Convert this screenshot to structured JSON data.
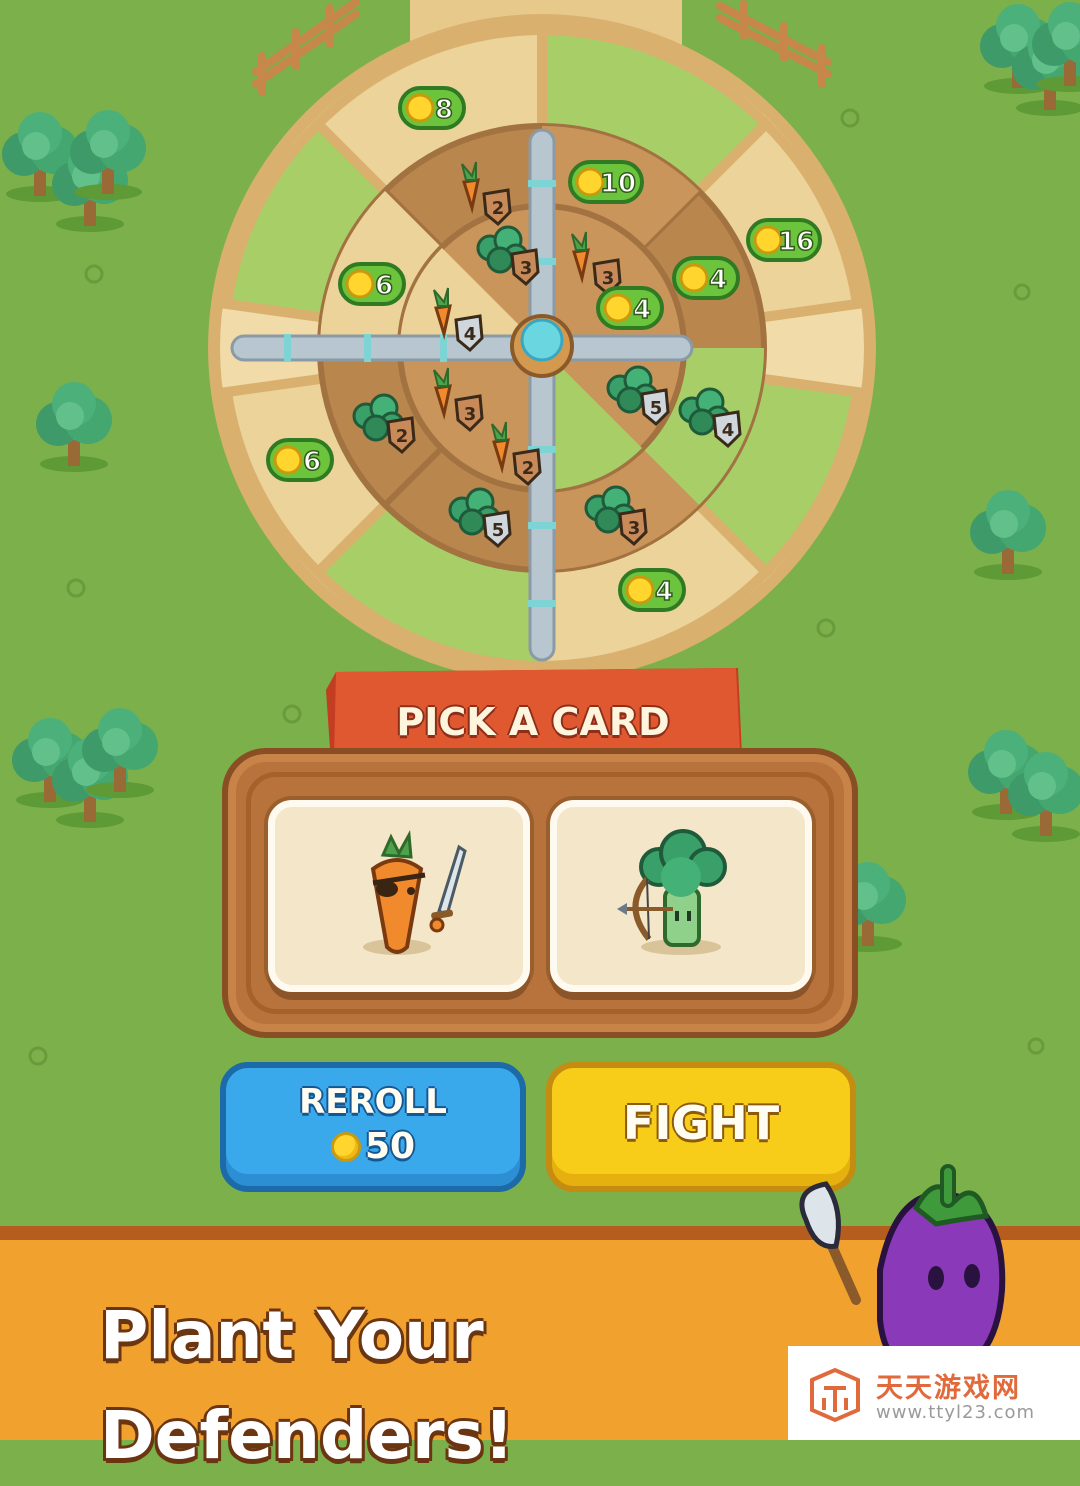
{
  "board": {
    "coin_badges": [
      "8",
      "10",
      "16",
      "6",
      "4",
      "4",
      "6",
      "4"
    ],
    "unit_levels": [
      "2",
      "3",
      "3",
      "4",
      "3",
      "2",
      "2",
      "5",
      "4",
      "5",
      "3"
    ]
  },
  "pick_card": {
    "title": "PICK A CARD",
    "cards": [
      {
        "unit": "carrot-swordsman"
      },
      {
        "unit": "broccoli-archer"
      }
    ]
  },
  "buttons": {
    "reroll_label": "REROLL",
    "reroll_cost": "50",
    "fight_label": "FIGHT"
  },
  "tagline": "Plant Your Defenders!",
  "watermark": {
    "site_name": "天天游戏网",
    "url": "www.ttyl23.com"
  },
  "colors": {
    "grass": "#7bb04a",
    "banner": "#e0582f",
    "reroll": "#39a9ec",
    "fight": "#f8cd1a",
    "ground": "#f0a12e",
    "coin": "#ffd52e"
  }
}
